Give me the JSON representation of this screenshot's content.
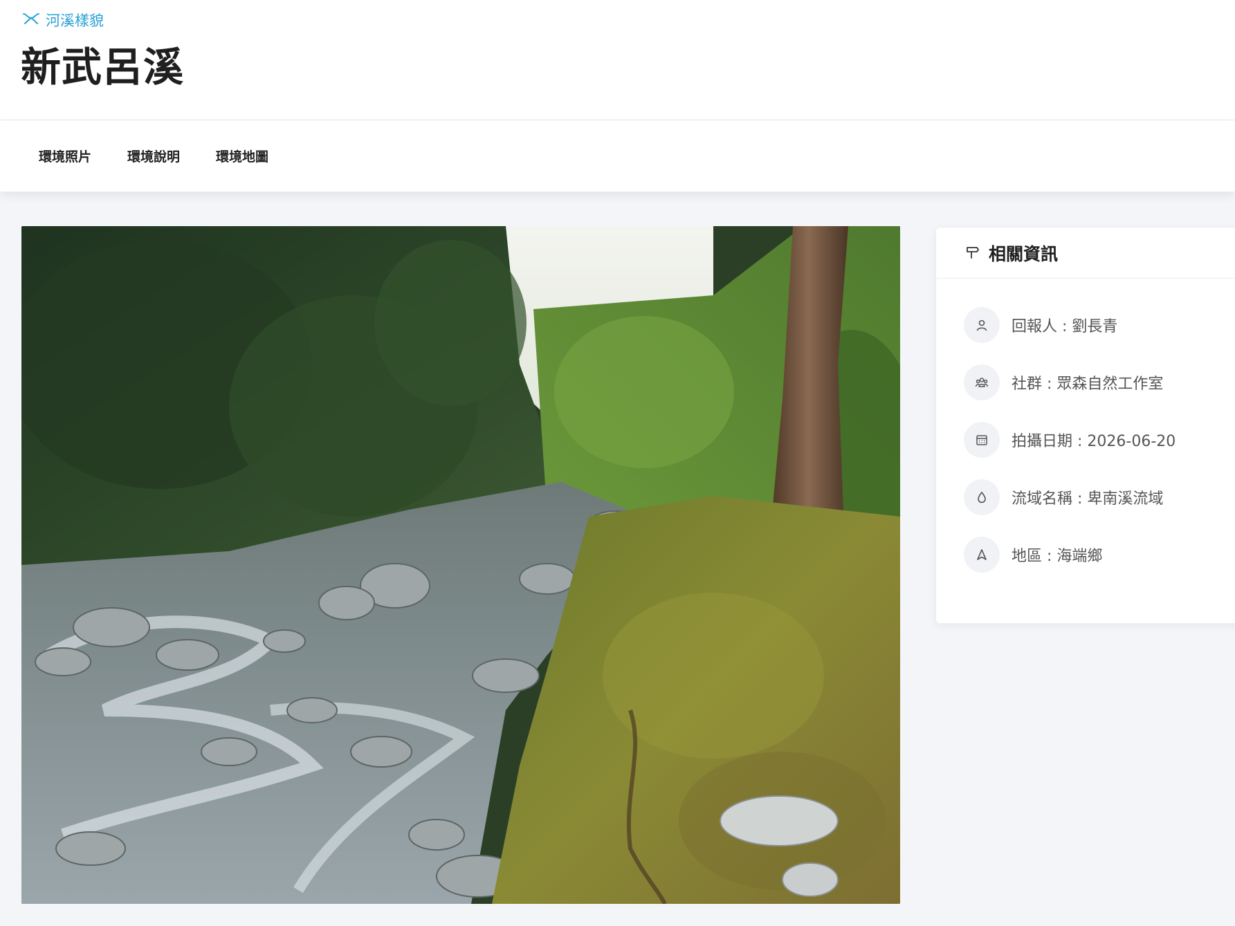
{
  "header": {
    "category_icon": "river-icon",
    "category_label": "河溪樣貌",
    "title": "新武呂溪"
  },
  "tabs": [
    {
      "label": "環境照片"
    },
    {
      "label": "環境說明"
    },
    {
      "label": "環境地圖"
    }
  ],
  "photo": {
    "description_icon": "river-photo"
  },
  "info_card": {
    "icon": "signpost-icon",
    "title": "相關資訊",
    "items": [
      {
        "icon": "user-icon",
        "text": "回報人 : 劉長青"
      },
      {
        "icon": "group-icon",
        "text": "社群 : 眾森自然工作室"
      },
      {
        "icon": "calendar-icon",
        "text": "拍攝日期 : 2026-06-20"
      },
      {
        "icon": "water-drop-icon",
        "text": "流域名稱 : 卑南溪流域"
      },
      {
        "icon": "navigation-icon",
        "text": "地區 : 海端鄉"
      }
    ]
  },
  "colors": {
    "accent": "#2aa0d6",
    "background": "#f4f5f8",
    "card": "#ffffff"
  }
}
